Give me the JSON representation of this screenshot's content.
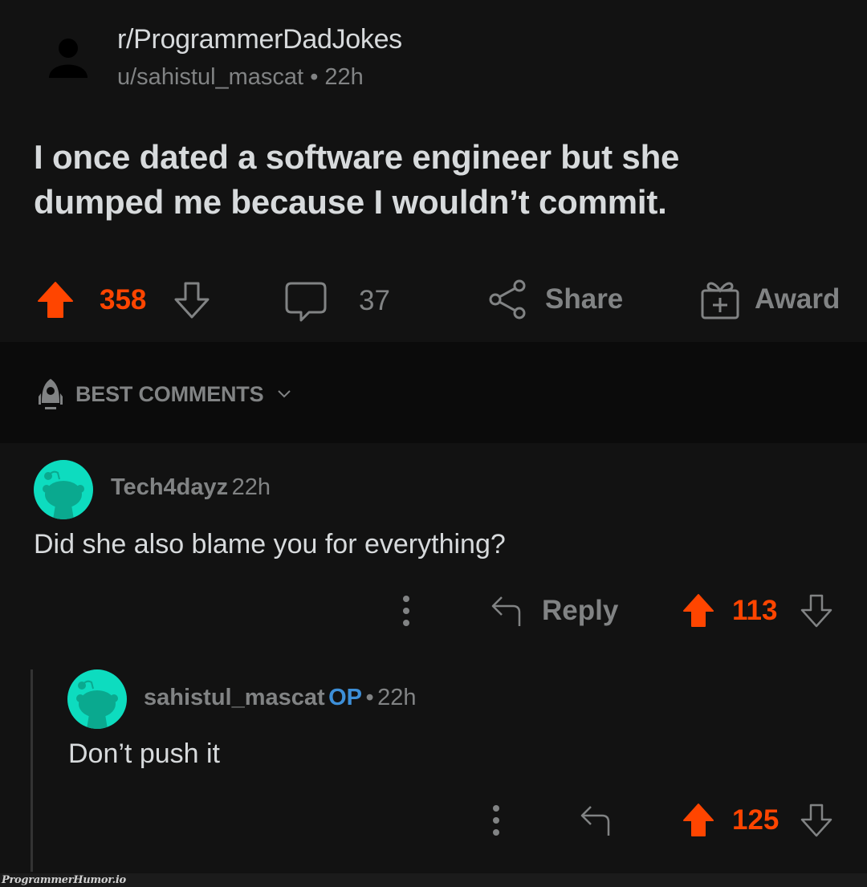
{
  "post": {
    "subreddit": "r/ProgrammerDadJokes",
    "author": "u/sahistul_mascat",
    "separator": "•",
    "age": "22h",
    "title": "I once dated a software engineer but she dumped me because I wouldn’t commit.",
    "score": "358",
    "comment_count": "37",
    "share_label": "Share",
    "award_label": "Award",
    "upvoted": true
  },
  "sort": {
    "label": "BEST COMMENTS",
    "icon": "rocket-icon"
  },
  "comments": [
    {
      "username": "Tech4dayz",
      "age": "22h",
      "body": "Did she also blame you for everything?",
      "reply_label": "Reply",
      "score": "113",
      "upvoted": true
    },
    {
      "username": "sahistul_mascat",
      "op_badge": "OP",
      "separator": "•",
      "age": "22h",
      "body": "Don’t push it",
      "score": "125",
      "upvoted": true
    }
  ],
  "colors": {
    "background": "#121212",
    "upvote": "#ff4500",
    "muted": "#818384",
    "text": "#d7dadc",
    "op": "#3d8fd8",
    "avatar": "#0ddcbf"
  },
  "watermark": "ProgrammerHumor.io"
}
